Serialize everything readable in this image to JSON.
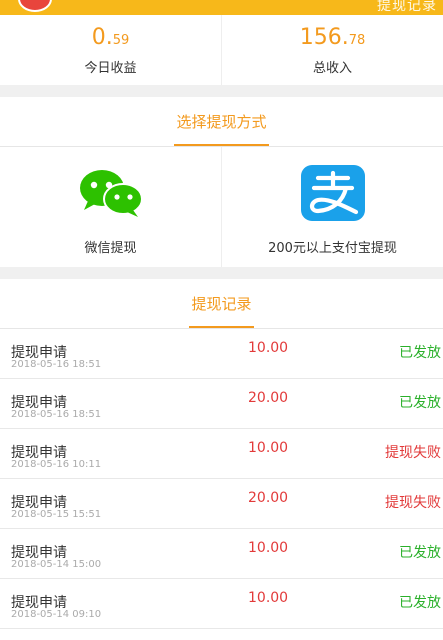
{
  "header": {
    "right_text": "提现记录"
  },
  "stats": {
    "today": {
      "int": "0.",
      "dec": "59",
      "label": "今日收益"
    },
    "total": {
      "int": "156.",
      "dec": "78",
      "label": "总收入"
    }
  },
  "withdraw": {
    "section_title": "选择提现方式",
    "methods": [
      {
        "label": "微信提现",
        "icon": "wechat-icon"
      },
      {
        "label": "200元以上支付宝提现",
        "icon": "alipay-icon"
      }
    ]
  },
  "records": {
    "section_title": "提现记录",
    "items": [
      {
        "title": "提现申请",
        "time": "2018-05-16 18:51",
        "amount": "10.00",
        "status": "已发放"
      },
      {
        "title": "提现申请",
        "time": "2018-05-16 18:51",
        "amount": "20.00",
        "status": "已发放"
      },
      {
        "title": "提现申请",
        "time": "2018-05-16 10:11",
        "amount": "10.00",
        "status": "提现失败"
      },
      {
        "title": "提现申请",
        "time": "2018-05-15 15:51",
        "amount": "20.00",
        "status": "提现失败"
      },
      {
        "title": "提现申请",
        "time": "2018-05-14 15:00",
        "amount": "10.00",
        "status": "已发放"
      },
      {
        "title": "提现申请",
        "time": "2018-05-14 09:10",
        "amount": "10.00",
        "status": "已发放"
      }
    ]
  },
  "colors": {
    "accent": "#f39a1e",
    "topbar": "#f7b81a",
    "success": "#2bb02b",
    "danger": "#e23a3a"
  }
}
